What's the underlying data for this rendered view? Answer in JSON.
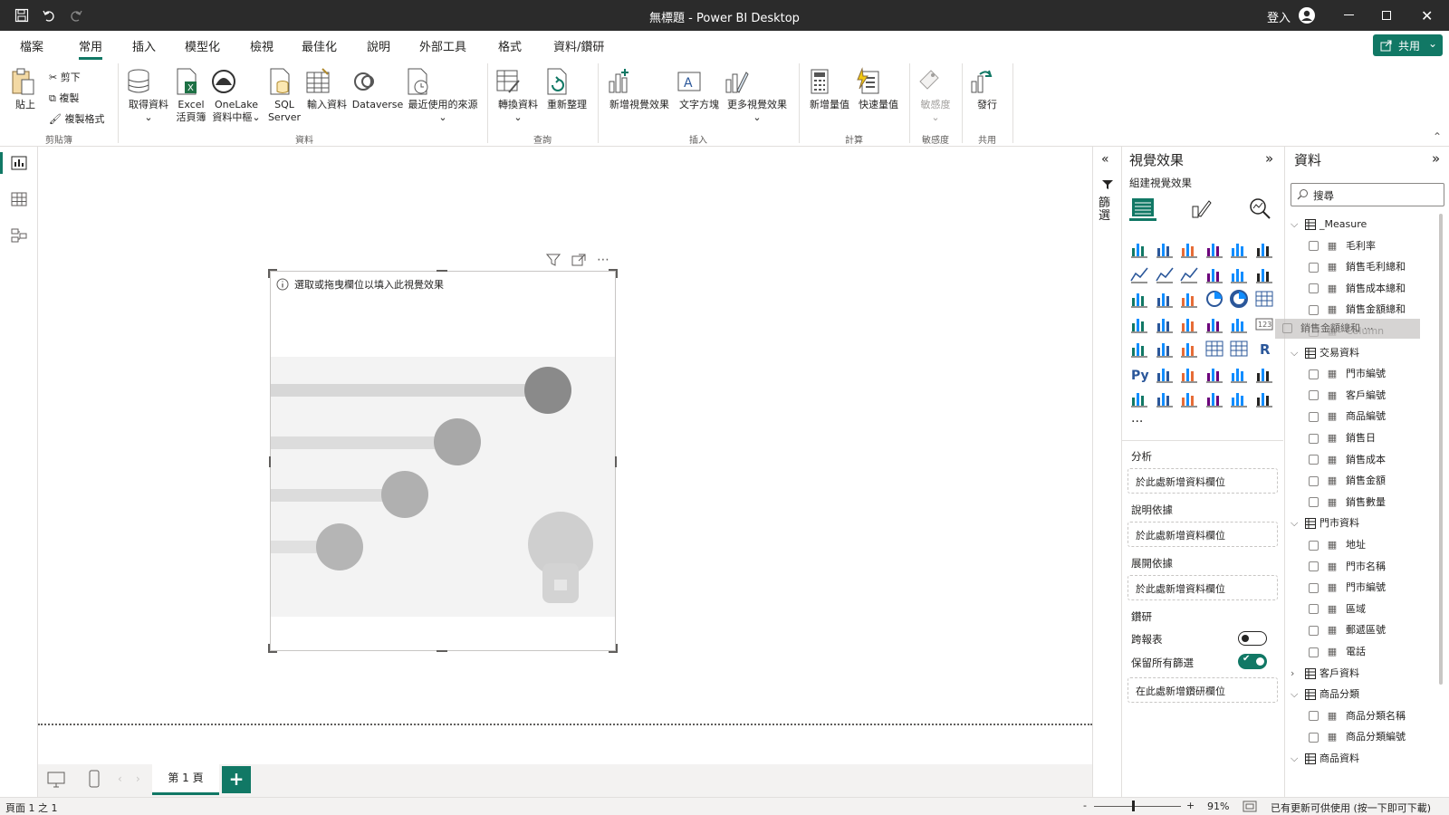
{
  "window": {
    "title": "無標題 - Power BI Desktop",
    "sign_in": "登入"
  },
  "menu_tabs": [
    "檔案",
    "常用",
    "插入",
    "模型化",
    "檢視",
    "最佳化",
    "說明",
    "外部工具",
    "格式",
    "資料/鑽研"
  ],
  "share_label": "共用",
  "ribbon": {
    "clipboard": {
      "paste": "貼上",
      "cut": "剪下",
      "copy": "複製",
      "format_painter": "複製格式",
      "group": "剪貼簿"
    },
    "data": {
      "get_data": "取得資料",
      "excel_l1": "Excel",
      "excel_l2": "活頁簿",
      "onelake_l1": "OneLake",
      "onelake_l2": "資料中樞",
      "sql_l1": "SQL",
      "sql_l2": "Server",
      "enter_data": "輸入資料",
      "dataverse": "Dataverse",
      "recent": "最近使用的來源",
      "group": "資料"
    },
    "queries": {
      "transform": "轉換資料",
      "refresh": "重新整理",
      "group": "查詢"
    },
    "insert": {
      "new_visual": "新增視覺效果",
      "text_box": "文字方塊",
      "more_visuals": "更多視覺效果",
      "group": "插入"
    },
    "calculations": {
      "new_measure": "新增量值",
      "quick_measure": "快速量值",
      "group": "計算"
    },
    "sensitivity": {
      "label": "敏感度",
      "group": "敏感度"
    },
    "share": {
      "publish": "發行",
      "group": "共用"
    }
  },
  "visual": {
    "hint": "選取或拖曳欄位以填入此視覺效果"
  },
  "pages": {
    "tab": "第 1 頁",
    "add": "+"
  },
  "status": {
    "page": "頁面 1 之 1",
    "zoom_minus": "-",
    "zoom_plus": "+",
    "zoom": "91%",
    "update": "已有更新可供使用 (按一下即可下載)"
  },
  "filters": {
    "label": "篩選"
  },
  "viz_pane": {
    "title": "視覺效果",
    "build": "組建視覺效果",
    "more": "...",
    "wells": [
      {
        "label": "分析",
        "placeholder": "於此處新增資料欄位"
      },
      {
        "label": "說明依據",
        "placeholder": "於此處新增資料欄位"
      },
      {
        "label": "展開依據",
        "placeholder": "於此處新增資料欄位"
      }
    ],
    "drill": {
      "title": "鑽研",
      "cross_report": "跨報表",
      "keep_filters": "保留所有篩選",
      "cross_report_on": false,
      "keep_filters_on": true,
      "placeholder": "在此處新增鑽研欄位"
    }
  },
  "data_pane": {
    "title": "資料",
    "search_placeholder": "搜尋",
    "drag_label": "銷售金額總和",
    "tree": [
      {
        "name": "_Measure",
        "expanded": true,
        "children": [
          "毛利率",
          "銷售毛利總和",
          "銷售成本總和",
          "銷售金額總和",
          "Column"
        ]
      },
      {
        "name": "交易資料",
        "expanded": true,
        "children": [
          "門市編號",
          "客戶編號",
          "商品編號",
          "銷售日",
          "銷售成本",
          "銷售金額",
          "銷售數量"
        ]
      },
      {
        "name": "門市資料",
        "expanded": true,
        "children": [
          "地址",
          "門市名稱",
          "門市編號",
          "區域",
          "郵遞區號",
          "電話"
        ]
      },
      {
        "name": "客戶資料",
        "expanded": false,
        "children": []
      },
      {
        "name": "商品分類",
        "expanded": true,
        "children": [
          "商品分類名稱",
          "商品分類編號"
        ]
      },
      {
        "name": "商品資料",
        "expanded": true,
        "children": []
      }
    ]
  },
  "colors": {
    "accent": "#117865",
    "titlebar": "#2b2b2b"
  }
}
